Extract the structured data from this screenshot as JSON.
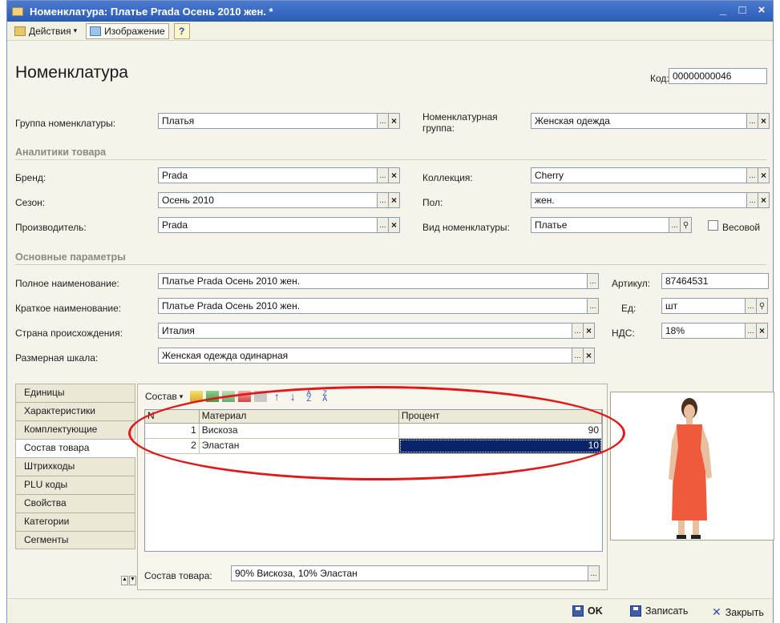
{
  "window": {
    "title": "Номенклатура: Платье Prada Осень 2010 жен. *",
    "controls": [
      "_",
      "□",
      "×"
    ]
  },
  "toolbar": {
    "actions_label": "Действия",
    "image_label": "Изображение",
    "help_label": "?"
  },
  "header": {
    "title": "Номенклатура",
    "code_label": "Код:",
    "code_value": "00000000046"
  },
  "form": {
    "group_label": "Группа номенклатуры:",
    "group_value": "Платья",
    "nomen_group_label": "Номенклатурная группа:",
    "nomen_group_value": "Женская одежда",
    "analytics_section": "Аналитики товара",
    "brand_label": "Бренд:",
    "brand_value": "Prada",
    "collection_label": "Коллекция:",
    "collection_value": "Cherry",
    "season_label": "Сезон:",
    "season_value": "Осень 2010",
    "gender_label": "Пол:",
    "gender_value": "жен.",
    "maker_label": "Производитель:",
    "maker_value": "Prada",
    "kind_label": "Вид номенклатуры:",
    "kind_value": "Платье",
    "weight_label": "Весовой",
    "main_section": "Основные параметры",
    "fullname_label": "Полное наименование:",
    "fullname_value": "Платье Prada Осень 2010 жен.",
    "article_label": "Артикул:",
    "article_value": "87464531",
    "shortname_label": "Краткое наименование:",
    "shortname_value": "Платье Prada Осень 2010 жен.",
    "unit_label": "Ед:",
    "unit_value": "шт",
    "country_label": "Страна происхождения:",
    "country_value": "Италия",
    "vat_label": "НДС:",
    "vat_value": "18%",
    "sizescale_label": "Размерная шкала:",
    "sizescale_value": "Женская одежда одинарная"
  },
  "tabs": [
    {
      "label": "Единицы"
    },
    {
      "label": "Характеристики"
    },
    {
      "label": "Комплектующие"
    },
    {
      "label": "Состав товара"
    },
    {
      "label": "Штрихкоды"
    },
    {
      "label": "PLU коды"
    },
    {
      "label": "Свойства"
    },
    {
      "label": "Категории"
    },
    {
      "label": "Сегменты"
    }
  ],
  "panel": {
    "menu_label": "Состав",
    "columns": [
      "N",
      "Материал",
      "Процент"
    ],
    "rows": [
      {
        "n": "1",
        "material": "Вискоза",
        "percent": "90"
      },
      {
        "n": "2",
        "material": "Эластан",
        "percent": "10"
      }
    ],
    "composition_label": "Состав товара:",
    "composition_value": "90% Вискоза, 10% Эластан"
  },
  "footer": {
    "ok_label": "OK",
    "save_label": "Записать",
    "close_label": "Закрыть"
  },
  "colors": {
    "title_bar": "#2b5bb5",
    "selection": "#0a246a",
    "highlight_ellipse": "#e01818",
    "dress": "#f05a3c"
  }
}
